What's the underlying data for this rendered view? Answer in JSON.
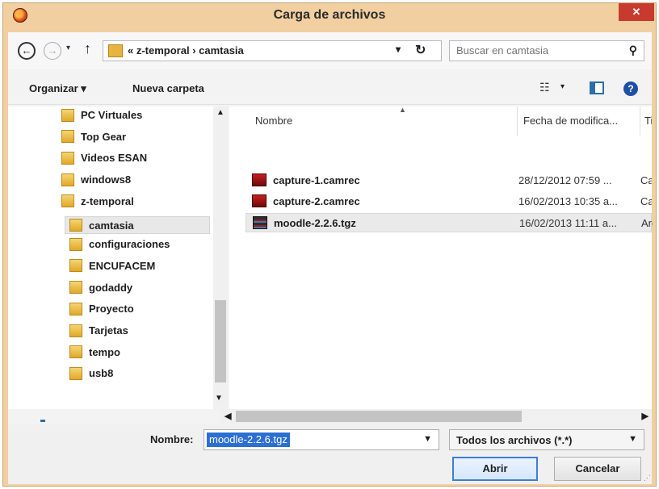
{
  "window": {
    "title": "Carga de archivos",
    "close_label": "✕"
  },
  "nav": {
    "back": "←",
    "forward": "→",
    "recent": "▾",
    "up": "↑",
    "address_path": "« z-temporal  ›  camtasia",
    "address_drop": "▾",
    "refresh": "↻"
  },
  "search": {
    "placeholder": "Buscar en camtasia",
    "icon": "search-icon"
  },
  "toolbar": {
    "organize_label": "Organizar ▾",
    "new_folder_label": "Nueva carpeta",
    "view_icon": "☷",
    "view_drop": "▾",
    "help": "?"
  },
  "sidebar": {
    "items": [
      {
        "label": "PC Virtuales",
        "level": 0
      },
      {
        "label": "Top Gear",
        "level": 0
      },
      {
        "label": "Videos ESAN",
        "level": 0
      },
      {
        "label": "windows8",
        "level": 0
      },
      {
        "label": "z-temporal",
        "level": 0
      },
      {
        "label": "camtasia",
        "level": 1,
        "selected": true
      },
      {
        "label": "configuraciones",
        "level": 1
      },
      {
        "label": "ENCUFACEM",
        "level": 1
      },
      {
        "label": "godaddy",
        "level": 1
      },
      {
        "label": "Proyecto",
        "level": 1
      },
      {
        "label": "Tarjetas",
        "level": 1
      },
      {
        "label": "tempo",
        "level": 1
      },
      {
        "label": "usb8",
        "level": 1
      }
    ]
  },
  "files": {
    "columns": {
      "name": "Nombre",
      "date": "Fecha de modifica...",
      "type": "Tip"
    },
    "rows": [
      {
        "name": "capture-1.camrec",
        "date": "28/12/2012 07:59 ...",
        "type": "Car",
        "icon": "camrec"
      },
      {
        "name": "capture-2.camrec",
        "date": "16/02/2013 10:35 a...",
        "type": "Car",
        "icon": "camrec"
      },
      {
        "name": "moodle-2.2.6.tgz",
        "date": "16/02/2013 11:11 a...",
        "type": "Arc",
        "icon": "tgz",
        "selected": true
      }
    ]
  },
  "footer": {
    "name_label": "Nombre:",
    "name_value": "moodle-2.2.6.tgz",
    "filter_value": "Todos los archivos (*.*)",
    "open_label": "Abrir",
    "cancel_label": "Cancelar"
  }
}
